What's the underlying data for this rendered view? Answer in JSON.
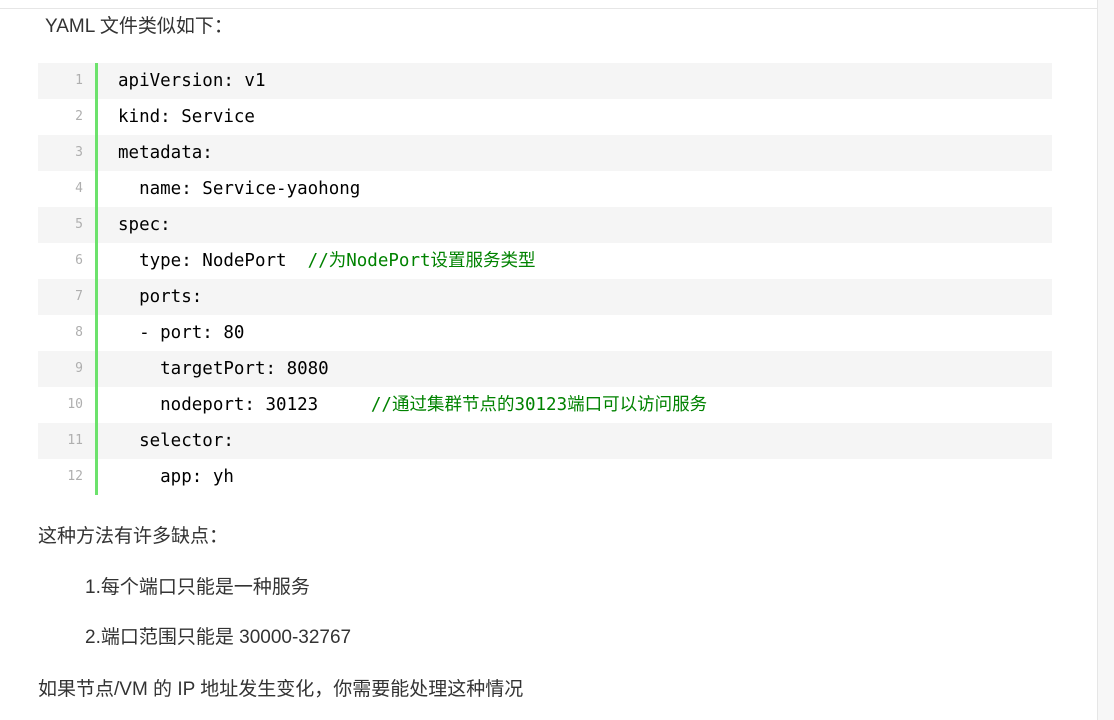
{
  "intro": "YAML 文件类似如下：",
  "code_block": {
    "lines": [
      {
        "number": "1",
        "text": "apiVersion: v1"
      },
      {
        "number": "2",
        "text": "kind: Service"
      },
      {
        "number": "3",
        "text": "metadata:"
      },
      {
        "number": "4",
        "text": "  name: Service-yaohong"
      },
      {
        "number": "5",
        "text": "spec:"
      },
      {
        "number": "6",
        "text": "  type: NodePort  ",
        "comment": "//为NodePort设置服务类型"
      },
      {
        "number": "7",
        "text": "  ports:"
      },
      {
        "number": "8",
        "text": "  - port: 80"
      },
      {
        "number": "9",
        "text": "    targetPort: 8080"
      },
      {
        "number": "10",
        "text": "    nodeport: 30123     ",
        "comment": "//通过集群节点的30123端口可以访问服务"
      },
      {
        "number": "11",
        "text": "  selector:"
      },
      {
        "number": "12",
        "text": "    app: yh"
      }
    ]
  },
  "drawbacks": {
    "heading": "这种方法有许多缺点：",
    "items": [
      "1.每个端口只能是一种服务",
      "2.端口范围只能是 30000-32767"
    ]
  },
  "closing": "如果节点/VM 的 IP 地址发生变化，你需要能处理这种情况",
  "theme": {
    "text_color": "#333333",
    "code_text_color": "#000000",
    "comment_color": "#008200",
    "gutter_border_color": "#6ce26c",
    "line_number_color": "#afafaf",
    "stripe_color": "#f5f5f5",
    "scrollbar_track_color": "#f7f7f7"
  }
}
